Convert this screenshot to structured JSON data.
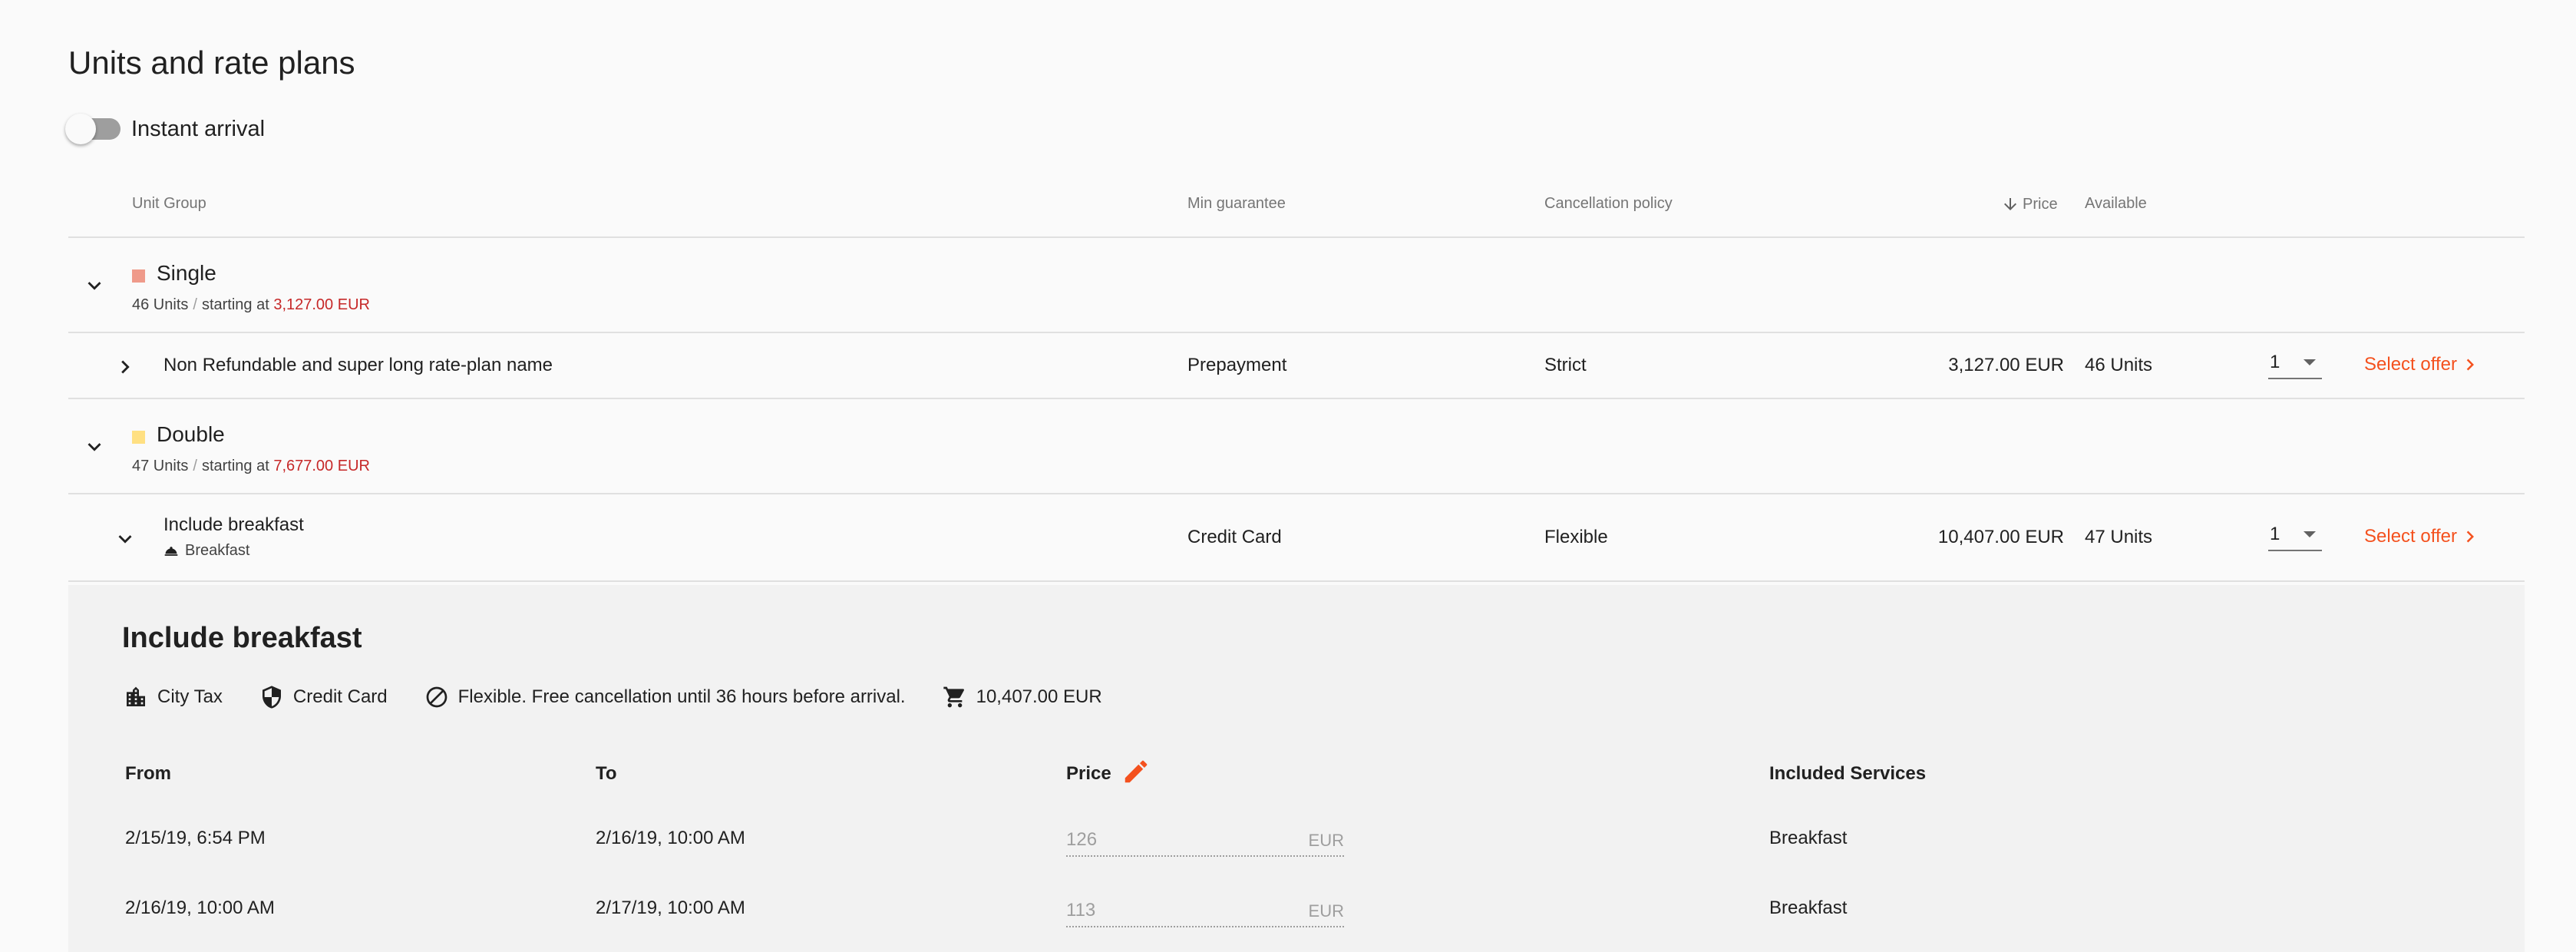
{
  "page": {
    "title": "Units and rate plans"
  },
  "toggle": {
    "label": "Instant arrival",
    "checked": false
  },
  "columns": {
    "unit_group": "Unit Group",
    "min_guarantee": "Min guarantee",
    "cancellation_policy": "Cancellation policy",
    "price": "Price",
    "available": "Available"
  },
  "groups": [
    {
      "name": "Single",
      "color": "#ef9a8a",
      "units": "46 Units",
      "sep": "/",
      "starting_label": "starting at",
      "starting_price": "3,127.00 EUR",
      "rate": {
        "name": "Non Refundable and super long rate-plan name",
        "min_guarantee": "Prepayment",
        "cancellation": "Strict",
        "price": "3,127.00 EUR",
        "available": "46 Units",
        "qty": "1",
        "action": "Select offer"
      }
    },
    {
      "name": "Double",
      "color": "#ffe082",
      "units": "47 Units",
      "sep": "/",
      "starting_label": "starting at",
      "starting_price": "7,677.00 EUR",
      "rate": {
        "name": "Include breakfast",
        "service": "Breakfast",
        "min_guarantee": "Credit Card",
        "cancellation": "Flexible",
        "price": "10,407.00 EUR",
        "available": "47 Units",
        "qty": "1",
        "action": "Select offer"
      }
    }
  ],
  "detail": {
    "title": "Include breakfast",
    "info": {
      "tax": "City Tax",
      "guarantee": "Credit Card",
      "cancellation": "Flexible. Free cancellation until 36 hours before arrival.",
      "total": "10,407.00 EUR"
    },
    "table": {
      "headers": {
        "from": "From",
        "to": "To",
        "price": "Price",
        "services": "Included Services"
      },
      "rows": [
        {
          "from": "2/15/19, 6:54 PM",
          "to": "2/16/19, 10:00 AM",
          "price": "126",
          "currency": "EUR",
          "services": "Breakfast"
        },
        {
          "from": "2/16/19, 10:00 AM",
          "to": "2/17/19, 10:00 AM",
          "price": "113",
          "currency": "EUR",
          "services": "Breakfast"
        }
      ]
    }
  },
  "icons": {
    "expand": "chevron-down-icon",
    "collapse": "chevron-right-icon",
    "select": "chevron-right-icon",
    "sort": "arrow-down-icon",
    "service": "room-service-icon",
    "tax": "city-icon",
    "guarantee": "shield-icon",
    "cancellation": "block-icon",
    "cart": "cart-icon",
    "edit": "pencil-icon"
  },
  "accent_color": "#f4511e",
  "price_color": "#c62828"
}
